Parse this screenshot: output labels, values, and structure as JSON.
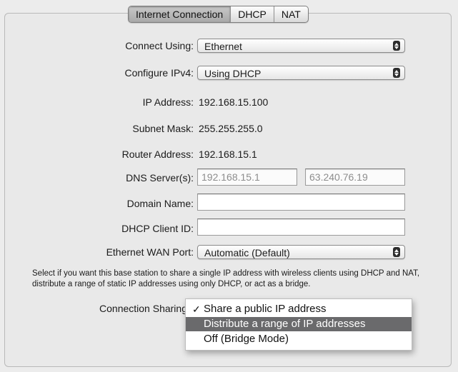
{
  "tabs": [
    {
      "label": "Internet Connection",
      "active": true
    },
    {
      "label": "DHCP",
      "active": false
    },
    {
      "label": "NAT",
      "active": false
    }
  ],
  "connect_using": {
    "label": "Connect Using:",
    "value": "Ethernet"
  },
  "configure_ipv4": {
    "label": "Configure IPv4:",
    "value": "Using DHCP"
  },
  "ip_address": {
    "label": "IP Address:",
    "value": "192.168.15.100"
  },
  "subnet_mask": {
    "label": "Subnet Mask:",
    "value": "255.255.255.0"
  },
  "router_address": {
    "label": "Router Address:",
    "value": "192.168.15.1"
  },
  "dns_servers": {
    "label": "DNS Server(s):",
    "primary": "192.168.15.1",
    "secondary": "63.240.76.19"
  },
  "domain_name": {
    "label": "Domain Name:",
    "value": ""
  },
  "dhcp_client_id": {
    "label": "DHCP Client ID:",
    "value": ""
  },
  "ethernet_wan_port": {
    "label": "Ethernet WAN Port:",
    "value": "Automatic (Default)"
  },
  "help_text": "Select if you want this base station to share a single IP address with wireless clients using DHCP and NAT, distribute a range of static IP addresses using only DHCP, or act as a bridge.",
  "connection_sharing": {
    "label": "Connection Sharing",
    "options": [
      {
        "label": "Share a public IP address",
        "checked": true,
        "highlighted": false
      },
      {
        "label": "Distribute a range of IP addresses",
        "checked": false,
        "highlighted": true
      },
      {
        "label": "Off (Bridge Mode)",
        "checked": false,
        "highlighted": false
      }
    ],
    "check_glyph": "✓"
  },
  "colors": {
    "panel_bg": "#e9e9e9",
    "menu_highlight": "#6a6a6c",
    "dim_text": "#8d8d8d"
  }
}
